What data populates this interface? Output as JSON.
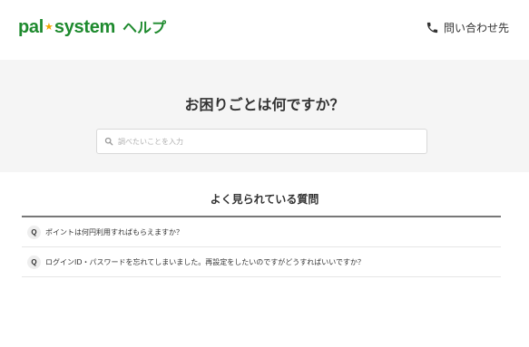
{
  "header": {
    "logo": {
      "part1": "pal",
      "star": "★",
      "part2": "system",
      "help": "ヘルプ"
    },
    "contact_label": "問い合わせ先",
    "contact_icon": "phone-icon"
  },
  "hero": {
    "title": "お困りごとは何ですか？",
    "search": {
      "placeholder": "調べたいことを入力",
      "value": "",
      "icon": "search-icon"
    }
  },
  "faq": {
    "heading": "よく見られている質問",
    "badge": "Q",
    "items": [
      {
        "text": "ポイントは何円利用すればもらえますか？"
      },
      {
        "text": "ログインID・パスワードを忘れてしまいました。再設定をしたいのですがどうすればいいですか？"
      }
    ]
  },
  "colors": {
    "brand_green": "#1e8a2e",
    "star_orange": "#f0a500",
    "hero_bg": "#f5f5f5",
    "text": "#333333"
  }
}
